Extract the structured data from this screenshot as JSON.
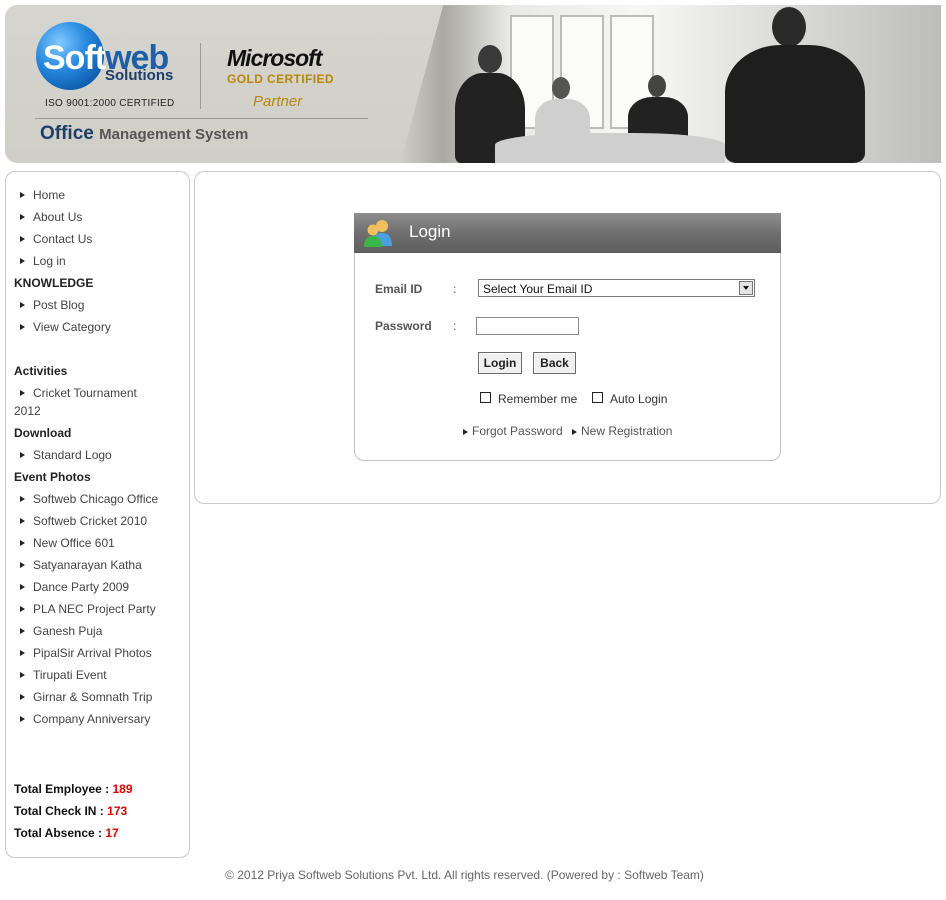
{
  "header": {
    "logo_soft": "Soft",
    "logo_web": "web",
    "logo_solutions": "Solutions",
    "iso": "ISO 9001:2000 CERTIFIED",
    "ms_title": "Microsoft",
    "ms_gold": "GOLD CERTIFIED",
    "ms_partner": "Partner",
    "system_office": "Office",
    "system_rest": "Management System"
  },
  "sidebar": {
    "nav": [
      "Home",
      "About Us",
      "Contact Us",
      "Log in"
    ],
    "knowledge_heading": "KNOWLEDGE",
    "knowledge": [
      "Post Blog",
      "View Category"
    ],
    "activities_heading": "Activities",
    "activities": [
      "Cricket Tournament 2012"
    ],
    "download_heading": "Download",
    "download": [
      "Standard Logo"
    ],
    "event_photos_heading": "Event Photos",
    "event_photos": [
      "Softweb Chicago Office",
      "Softweb Cricket 2010",
      "New Office 601",
      "Satyanarayan Katha",
      "Dance Party 2009",
      "PLA NEC Project Party",
      "Ganesh Puja",
      "PipalSir Arrival Photos",
      "Tirupati Event",
      "Girnar & Somnath Trip",
      "Company Anniversary"
    ],
    "stats": {
      "employee_label": "Total Employee :",
      "employee_value": "189",
      "checkin_label": "Total Check IN :",
      "checkin_value": "173",
      "absence_label": "Total Absence :",
      "absence_value": "17"
    }
  },
  "login": {
    "title": "Login",
    "email_label": "Email ID",
    "email_colon": ":",
    "email_select_value": "Select Your Email ID",
    "password_label": "Password",
    "password_colon": ":",
    "password_value": "",
    "login_button": "Login",
    "back_button": "Back",
    "remember_me": "Remember me",
    "auto_login": "Auto Login",
    "forgot_password": "Forgot Password",
    "new_registration": "New Registration"
  },
  "footer": {
    "text": "© 2012 Priya Softweb Solutions Pvt. Ltd. All rights reserved. (Powered by : Softweb Team)"
  }
}
